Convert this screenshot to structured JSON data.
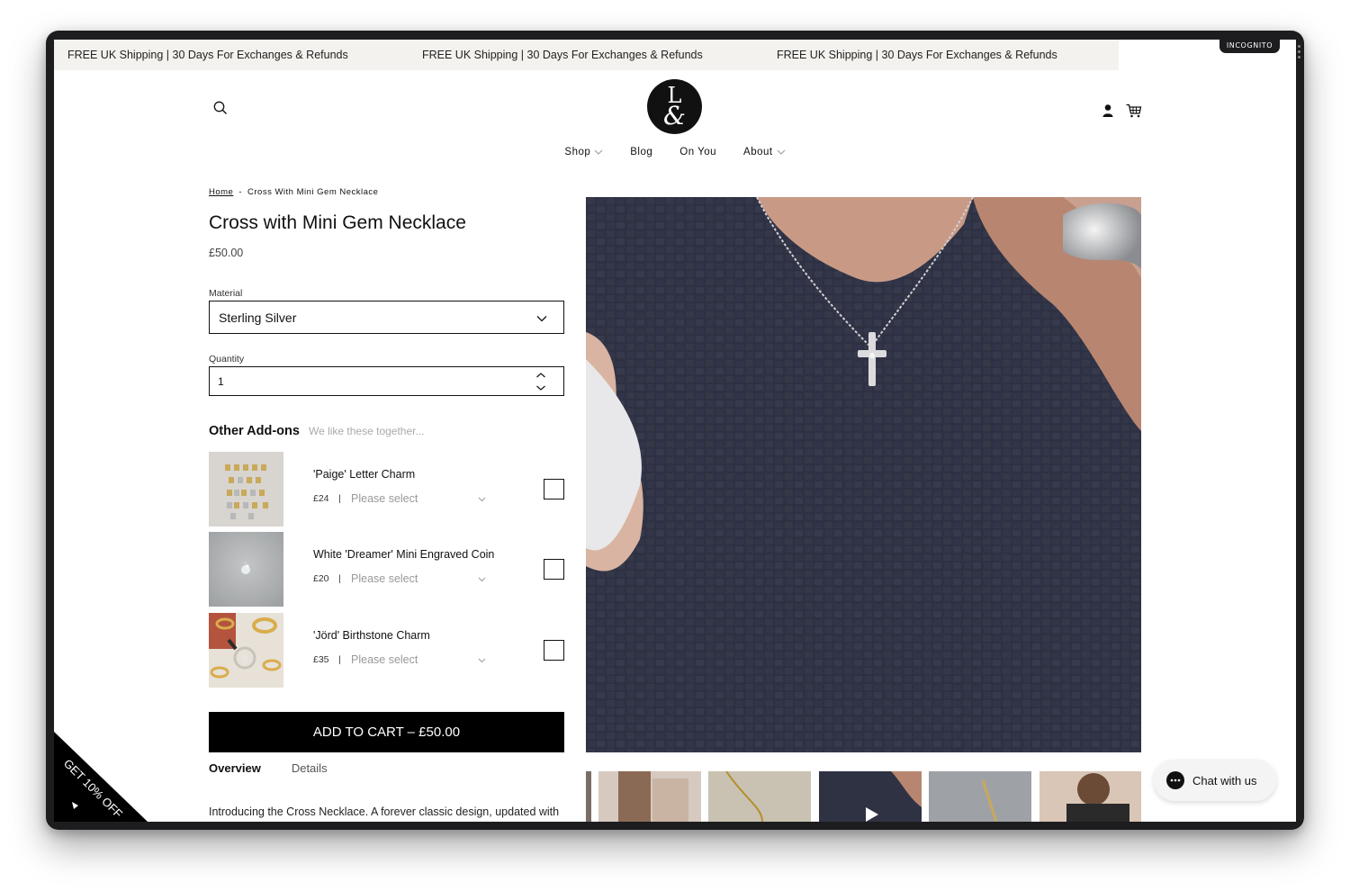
{
  "browser": {
    "incognito_label": "INCOGNITO"
  },
  "announcement": {
    "messages": [
      "FREE UK Shipping | 30 Days For Exchanges & Refunds",
      "FREE UK Shipping | 30 Days For Exchanges & Refunds",
      "FREE UK Shipping | 30 Days For Exchanges & Refunds"
    ]
  },
  "header": {
    "logo": {
      "top": "L",
      "bottom": "&"
    },
    "icons": {
      "search": "search-icon",
      "account": "user-icon",
      "cart": "cart-icon"
    }
  },
  "nav": {
    "items": [
      {
        "label": "Shop",
        "has_dropdown": true
      },
      {
        "label": "Blog",
        "has_dropdown": false
      },
      {
        "label": "On You",
        "has_dropdown": false
      },
      {
        "label": "About",
        "has_dropdown": true
      }
    ]
  },
  "breadcrumb": {
    "home": "Home",
    "separator": "-",
    "current": "Cross With Mini Gem Necklace"
  },
  "product": {
    "title": "Cross with Mini Gem Necklace",
    "price": "£50.00",
    "material_label": "Material",
    "material_value": "Sterling Silver",
    "quantity_label": "Quantity",
    "quantity_value": "1"
  },
  "addons": {
    "heading": "Other Add-ons",
    "subheading": "We like these together...",
    "items": [
      {
        "name": "'Paige' Letter Charm",
        "price": "£24",
        "separator": "|",
        "select_placeholder": "Please select",
        "checked": false
      },
      {
        "name": "White 'Dreamer' Mini Engraved Coin",
        "price": "£20",
        "separator": "|",
        "select_placeholder": "Please select",
        "checked": false
      },
      {
        "name": "'Jörd' Birthstone Charm",
        "price": "£35",
        "separator": "|",
        "select_placeholder": "Please select",
        "checked": false
      }
    ]
  },
  "cart": {
    "add_label": "ADD TO CART – £50.00"
  },
  "tabs": {
    "overview": "Overview",
    "details": "Details"
  },
  "description": "Introducing the Cross Necklace. A forever classic design, updated with",
  "promo": {
    "label": "GET 10% OFF"
  },
  "chat": {
    "label": "Chat with us"
  },
  "colors": {
    "accent": "#000000",
    "announce_bg": "#f3f2ee",
    "image_bg": "#2f3242"
  }
}
